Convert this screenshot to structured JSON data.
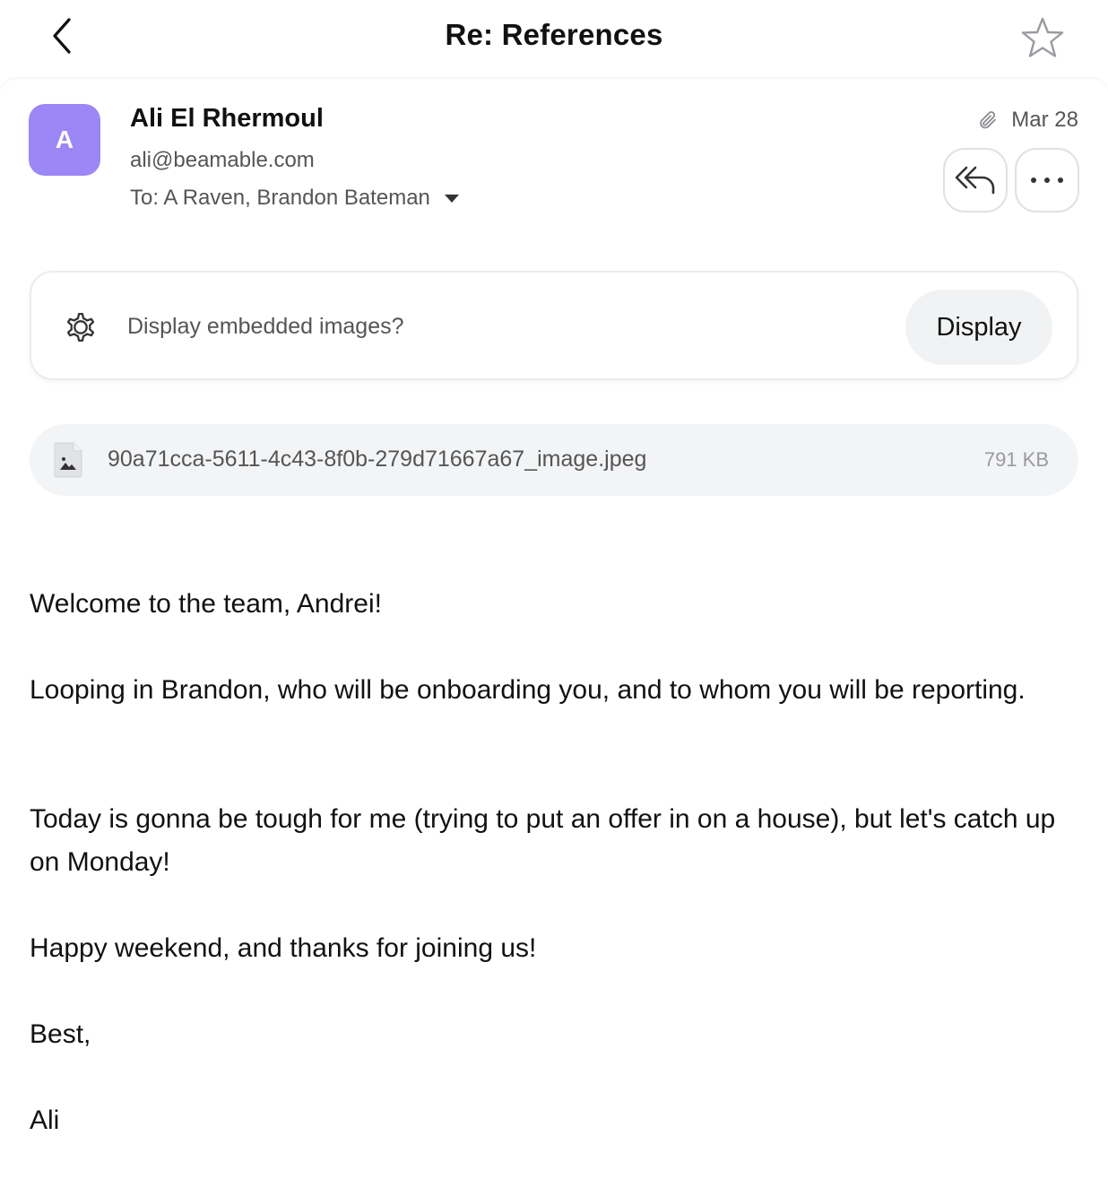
{
  "header": {
    "title": "Re: References",
    "back_icon": "chevron-left-icon",
    "star_icon": "star-outline-icon"
  },
  "message": {
    "avatar_initial": "A",
    "avatar_color": "#9b87f5",
    "sender_name": "Ali El Rhermoul",
    "sender_email": "ali@beamable.com",
    "recipients": "To: A Raven, Brandon Bateman",
    "date": "Mar 28",
    "has_attachment_icon": "paperclip-icon",
    "actions": {
      "reply_all_icon": "reply-all-icon",
      "more_icon": "more-horizontal-icon"
    }
  },
  "images_prompt": {
    "text": "Display embedded images?",
    "button_label": "Display",
    "icon": "gear-icon"
  },
  "attachment": {
    "filename": "90a71cca-5611-4c43-8f0b-279d71667a67_image.jpeg",
    "size": "791 KB",
    "icon": "image-file-icon"
  },
  "body": {
    "paragraphs": [
      "Welcome to the team, Andrei!",
      "Looping in Brandon, who will be onboarding you, and to whom you will be reporting.",
      "Today is gonna be tough for me (trying to put an offer in on a house), but let's catch up on Monday!",
      "Happy weekend, and thanks for joining us!",
      "Best,",
      "Ali"
    ]
  }
}
